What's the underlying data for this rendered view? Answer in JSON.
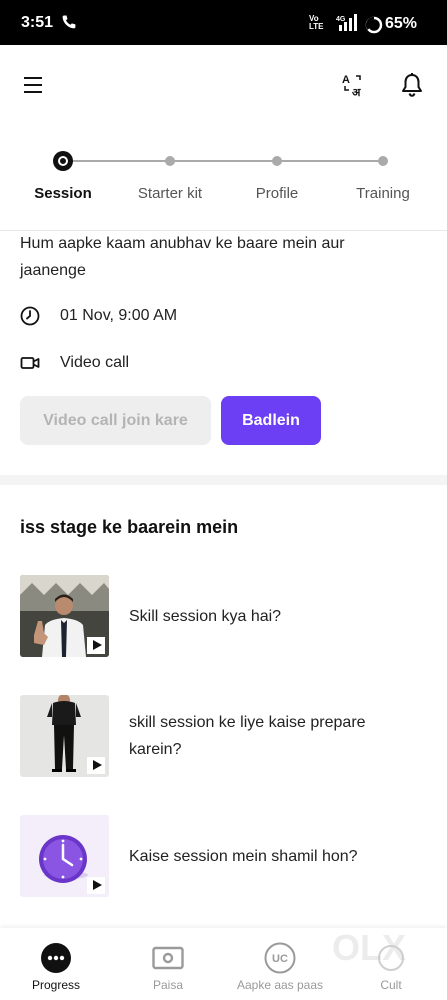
{
  "status_bar": {
    "time": "3:51",
    "network": "4G",
    "volte": [
      "Vo",
      "LTE"
    ],
    "battery": "65%"
  },
  "header": {
    "menu_icon": "hamburger-icon",
    "translate_icon": "translate-icon",
    "notification_icon": "bell-icon"
  },
  "stepper": {
    "steps": [
      {
        "label": "Session",
        "active": true
      },
      {
        "label": "Starter kit",
        "active": false
      },
      {
        "label": "Profile",
        "active": false
      },
      {
        "label": "Training",
        "active": false
      }
    ]
  },
  "session": {
    "description": "Hum aapke kaam anubhav ke baare mein aur jaanenge",
    "datetime": "01 Nov, 9:00 AM",
    "call_type": "Video call",
    "join_button": "Video call join kare",
    "change_button": "Badlein",
    "accent_color": "#6c3ff5"
  },
  "about": {
    "title": "iss stage ke baarein mein",
    "videos": [
      {
        "title": "Skill session kya hai?"
      },
      {
        "title": "skill session ke liye kaise prepare karein?"
      },
      {
        "title": "Kaise session mein shamil hon?"
      }
    ]
  },
  "bottom_nav": {
    "items": [
      {
        "label": "Progress",
        "icon": "progress-icon",
        "active": true
      },
      {
        "label": "Paisa",
        "icon": "paisa-icon",
        "active": false
      },
      {
        "label": "Aapke aas paas",
        "icon": "uc-icon",
        "active": false
      },
      {
        "label": "Cult",
        "icon": "cult-icon",
        "active": false
      }
    ]
  },
  "watermark": "OLX"
}
